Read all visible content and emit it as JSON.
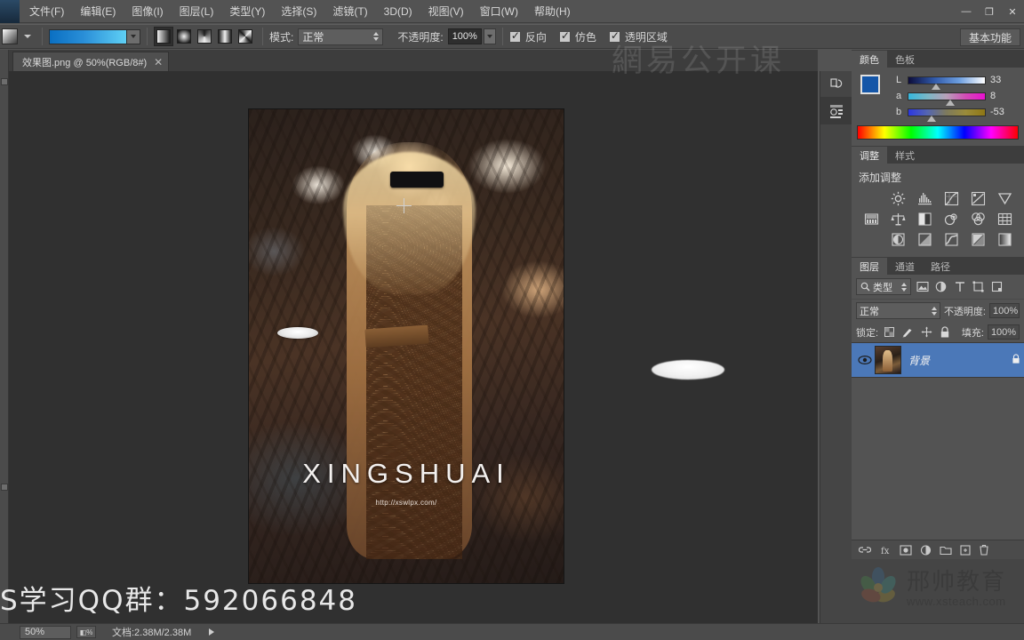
{
  "app": {
    "title": "Adobe Photoshop",
    "workspace_button": "基本功能"
  },
  "menubar": {
    "items": [
      {
        "label": "文件(F)"
      },
      {
        "label": "编辑(E)"
      },
      {
        "label": "图像(I)"
      },
      {
        "label": "图层(L)"
      },
      {
        "label": "类型(Y)"
      },
      {
        "label": "选择(S)"
      },
      {
        "label": "滤镜(T)"
      },
      {
        "label": "3D(D)"
      },
      {
        "label": "视图(V)"
      },
      {
        "label": "窗口(W)"
      },
      {
        "label": "帮助(H)"
      }
    ],
    "window_controls": {
      "minimize": "—",
      "restore": "❐",
      "close": "✕"
    }
  },
  "options_bar": {
    "tool": "gradient-tool",
    "gradient_types": [
      {
        "name": "linear-gradient",
        "selected": true
      },
      {
        "name": "radial-gradient",
        "selected": false
      },
      {
        "name": "angle-gradient",
        "selected": false
      },
      {
        "name": "reflected-gradient",
        "selected": false
      },
      {
        "name": "diamond-gradient",
        "selected": false
      }
    ],
    "mode_label": "模式:",
    "mode_value": "正常",
    "opacity_label": "不透明度:",
    "opacity_value": "100%",
    "checkboxes": [
      {
        "label": "反向",
        "checked": true
      },
      {
        "label": "仿色",
        "checked": true
      },
      {
        "label": "透明区域",
        "checked": true
      }
    ]
  },
  "document": {
    "tab_title": "效果图.png @ 50%(RGB/8#)",
    "close_glyph": "✕"
  },
  "canvas": {
    "brand_text": "XINGSHUAI",
    "brand_url": "http://xswlpx.com/",
    "promo_overlay": "S学习QQ群：592066848",
    "watermark_netease": "網易公开课"
  },
  "color_panel": {
    "tabs": [
      {
        "label": "颜色",
        "active": true
      },
      {
        "label": "色板",
        "active": false
      }
    ],
    "foreground_color": "#1456a8",
    "background_color": "#b9e4f5",
    "sliders": [
      {
        "label": "L",
        "value": "33"
      },
      {
        "label": "a",
        "value": "8"
      },
      {
        "label": "b",
        "value": "-53"
      }
    ]
  },
  "adjustments_panel": {
    "tabs": [
      {
        "label": "调整",
        "active": true
      },
      {
        "label": "样式",
        "active": false
      }
    ],
    "heading": "添加调整",
    "icons": [
      {
        "name": "brightness-contrast-icon"
      },
      {
        "name": "levels-icon"
      },
      {
        "name": "curves-icon"
      },
      {
        "name": "exposure-icon"
      },
      {
        "name": "vibrance-icon"
      },
      {
        "name": "hue-saturation-icon"
      },
      {
        "name": "color-balance-icon"
      },
      {
        "name": "black-white-icon"
      },
      {
        "name": "photo-filter-icon"
      },
      {
        "name": "channel-mixer-icon"
      },
      {
        "name": "color-lookup-icon"
      },
      {
        "name": "invert-icon"
      },
      {
        "name": "posterize-icon"
      },
      {
        "name": "threshold-icon"
      },
      {
        "name": "selective-color-icon"
      },
      {
        "name": "gradient-map-icon"
      }
    ]
  },
  "layers_panel": {
    "tabs": [
      {
        "label": "图层",
        "active": true
      },
      {
        "label": "通道",
        "active": false
      },
      {
        "label": "路径",
        "active": false
      }
    ],
    "filter_label": "类型",
    "filter_icons": [
      {
        "name": "pixel-layer-filter-icon"
      },
      {
        "name": "adjustment-layer-filter-icon"
      },
      {
        "name": "type-layer-filter-icon"
      },
      {
        "name": "shape-layer-filter-icon"
      },
      {
        "name": "smart-object-filter-icon"
      }
    ],
    "blend_mode": "正常",
    "opacity_label": "不透明度:",
    "opacity_value": "100%",
    "lock_label": "锁定:",
    "lock_icons": [
      {
        "name": "lock-transparent-pixels-icon"
      },
      {
        "name": "lock-image-pixels-icon"
      },
      {
        "name": "lock-position-icon"
      },
      {
        "name": "lock-all-icon"
      }
    ],
    "fill_label": "填充:",
    "fill_value": "100%",
    "layers": [
      {
        "name": "背景",
        "visible": true,
        "locked": true,
        "selected": true
      }
    ],
    "footer_icons": [
      {
        "name": "link-layers-icon"
      },
      {
        "name": "layer-style-icon"
      },
      {
        "name": "layer-mask-icon"
      },
      {
        "name": "new-fill-adjustment-icon"
      },
      {
        "name": "new-group-icon"
      },
      {
        "name": "new-layer-icon"
      },
      {
        "name": "delete-layer-icon"
      }
    ]
  },
  "dock_strip": {
    "icons": [
      {
        "name": "history-panel-icon"
      },
      {
        "name": "properties-panel-icon"
      }
    ]
  },
  "status_bar": {
    "zoom": "50%",
    "doc_info": "文档:2.38M/2.38M"
  },
  "watermark": {
    "brand_cn": "邢帅教育",
    "brand_en": "www.xsteach.com"
  }
}
